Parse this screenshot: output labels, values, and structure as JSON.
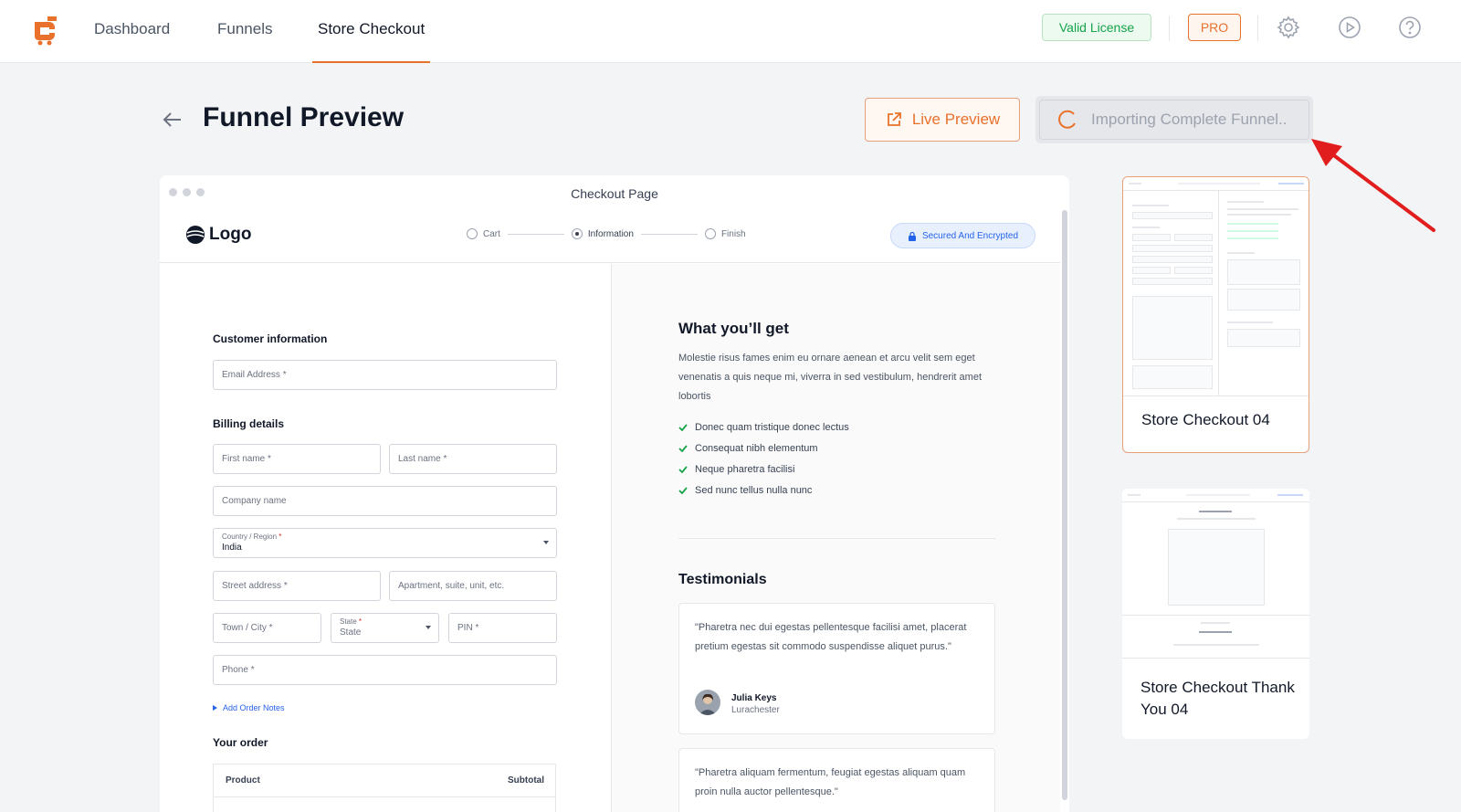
{
  "nav": {
    "tabs": [
      "Dashboard",
      "Funnels",
      "Store Checkout"
    ],
    "license_badge": "Valid License",
    "pro_badge": "PRO"
  },
  "header": {
    "title": "Funnel Preview",
    "live_preview_label": "Live Preview",
    "import_label": "Importing Complete Funnel.."
  },
  "preview": {
    "window_title": "Checkout Page",
    "logo_text": "Logo",
    "steps": [
      "Cart",
      "Information",
      "Finish"
    ],
    "secured_label": "Secured And Encrypted",
    "customer_info": {
      "title": "Customer information",
      "email_placeholder": "Email Address *"
    },
    "billing": {
      "title": "Billing details",
      "first_name": "First name *",
      "last_name": "Last name *",
      "company": "Company name",
      "country_label": "Country / Region",
      "country_value": "India",
      "street": "Street address *",
      "apartment": "Apartment, suite, unit, etc.",
      "town": "Town / City *",
      "state_label": "State",
      "state_value": "State",
      "pin": "PIN *",
      "phone": "Phone *",
      "add_notes": "Add Order Notes"
    },
    "order": {
      "title": "Your order",
      "col_product": "Product",
      "col_subtotal": "Subtotal"
    },
    "what_you_get": {
      "title": "What you’ll get",
      "text": "Molestie risus fames enim eu ornare aenean et arcu velit sem eget venenatis a quis neque mi, viverra in sed vestibulum, hendrerit amet lobortis",
      "items": [
        "Donec quam tristique donec lectus",
        "Consequat nibh elementum",
        "Neque pharetra facilisi",
        "Sed nunc tellus nulla nunc"
      ]
    },
    "testimonials": {
      "title": "Testimonials",
      "items": [
        {
          "quote": "\"Pharetra nec dui egestas pellentesque facilisi amet, placerat pretium egestas sit commodo suspendisse aliquet purus.\"",
          "name": "Julia Keys",
          "location": "Lurachester"
        },
        {
          "quote": "\"Pharetra aliquam fermentum, feugiat egestas aliquam quam proin nulla auctor pellentesque.\""
        }
      ]
    }
  },
  "templates": [
    {
      "label": "Store Checkout 04",
      "selected": true
    },
    {
      "label": "Store Checkout Thank You 04",
      "selected": false
    }
  ],
  "colors": {
    "accent": "#e8722c",
    "success": "#16a34a",
    "link": "#2563eb",
    "annotation": "#e11d1d"
  }
}
